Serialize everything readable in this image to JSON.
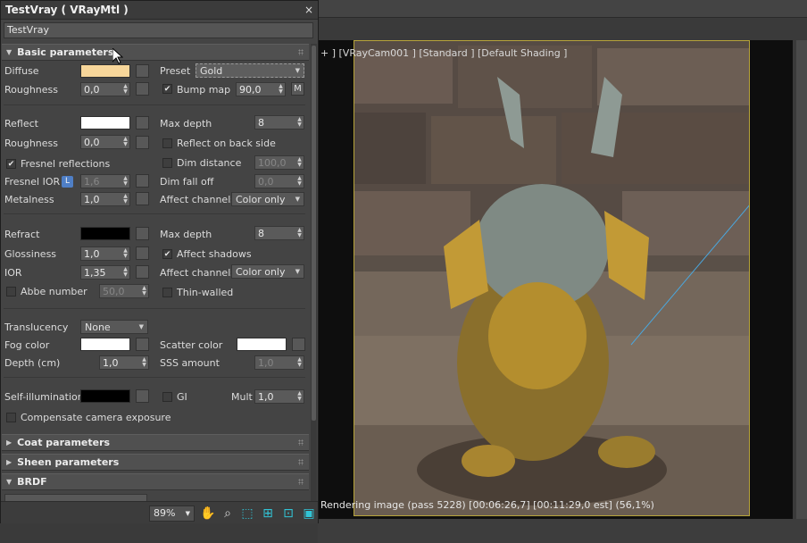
{
  "window": {
    "title": "TestVray  ( VRayMtl )",
    "close": "×",
    "material_name": "TestVray"
  },
  "basic": {
    "header": "Basic parameters",
    "diffuse": {
      "label": "Diffuse",
      "color": "#f7d69a"
    },
    "preset": {
      "label": "Preset",
      "value": "Gold"
    },
    "roughness1": {
      "label": "Roughness",
      "value": "0,0"
    },
    "bump": {
      "label": "Bump map",
      "value": "90,0",
      "button": "M"
    },
    "reflect": {
      "label": "Reflect",
      "color": "#ffffff"
    },
    "max_depth1": {
      "label": "Max depth",
      "value": "8"
    },
    "roughness2": {
      "label": "Roughness",
      "value": "0,0"
    },
    "reflect_back": {
      "label": "Reflect on back side"
    },
    "fresnel": {
      "label": "Fresnel reflections"
    },
    "dim_distance": {
      "label": "Dim distance",
      "value": "100,0"
    },
    "fresnel_ior": {
      "label": "Fresnel IOR",
      "lock": "L",
      "value": "1,6"
    },
    "dim_falloff": {
      "label": "Dim fall off",
      "value": "0,0"
    },
    "metalness": {
      "label": "Metalness",
      "value": "1,0"
    },
    "affect_channels1": {
      "label": "Affect channels",
      "value": "Color only"
    },
    "refract": {
      "label": "Refract",
      "color": "#000000"
    },
    "max_depth2": {
      "label": "Max depth",
      "value": "8"
    },
    "glossiness": {
      "label": "Glossiness",
      "value": "1,0"
    },
    "affect_shadows": {
      "label": "Affect shadows"
    },
    "ior": {
      "label": "IOR",
      "value": "1,35"
    },
    "affect_channels2": {
      "label": "Affect channels",
      "value": "Color only"
    },
    "abbe": {
      "label": "Abbe number",
      "value": "50,0"
    },
    "thin_walled": {
      "label": "Thin-walled"
    },
    "translucency": {
      "label": "Translucency",
      "value": "None"
    },
    "fog_color": {
      "label": "Fog color",
      "color": "#ffffff"
    },
    "scatter_color": {
      "label": "Scatter color",
      "color": "#ffffff"
    },
    "depth": {
      "label": "Depth (cm)",
      "value": "1,0"
    },
    "sss": {
      "label": "SSS amount",
      "value": "1,0"
    },
    "self_illum": {
      "label": "Self-illumination",
      "color": "#000000"
    },
    "gi": {
      "label": "GI"
    },
    "mult": {
      "label": "Mult",
      "value": "1,0"
    },
    "compensate": {
      "label": "Compensate camera exposure"
    }
  },
  "rollouts": {
    "coat": "Coat parameters",
    "sheen": "Sheen parameters",
    "brdf": "BRDF"
  },
  "toolbar": {
    "zoom": "89%"
  },
  "viewport": {
    "label": "+ ] [VRayCam001 ] [Standard ] [Default Shading ]",
    "status": "Rendering image (pass 5228) [00:06:26,7] [00:11:29,0 est]   (56,1%)"
  },
  "icons": [
    "close-icon",
    "collapse-triangle-icon",
    "grip-icon",
    "spinner-arrows-icon",
    "dropdown-arrow-icon",
    "checkmark-icon",
    "hand-pan-icon",
    "zoom-icon",
    "zoom-region-icon",
    "zoom-extents-icon",
    "frame-selected-icon",
    "highlight-icon",
    "mouse-cursor-icon"
  ],
  "colors": {
    "accent": "#31c4d6",
    "render_frame": "#b7a43a",
    "lock_badge": "#4f7fc6"
  }
}
